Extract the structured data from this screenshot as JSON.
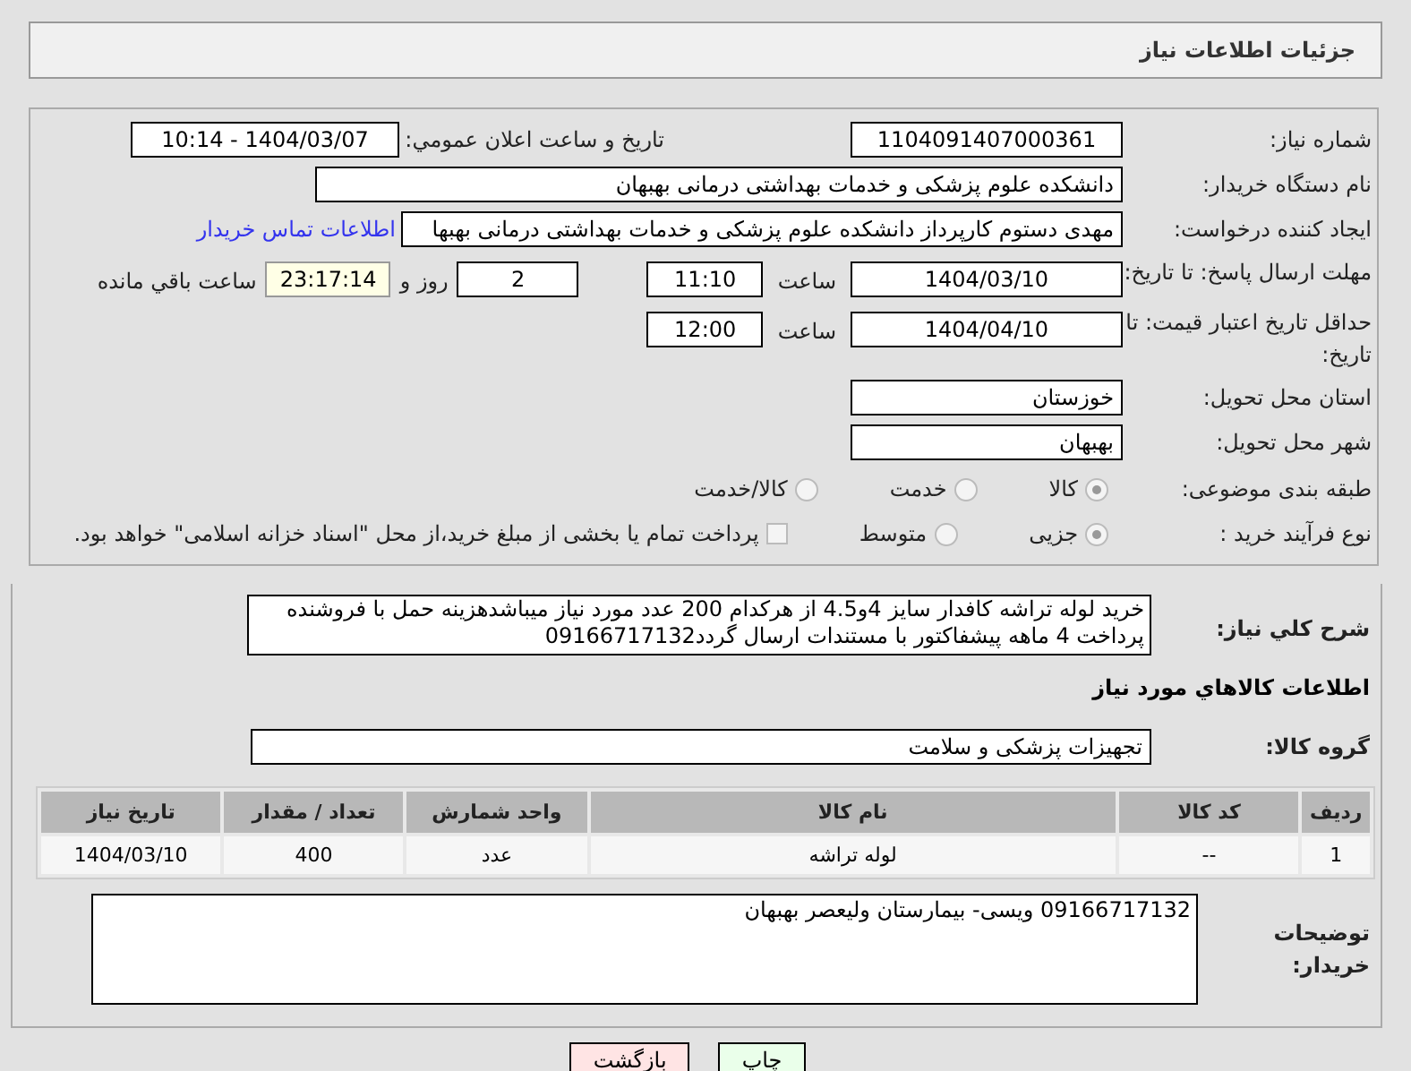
{
  "header": {
    "title": "جزئیات اطلاعات نیاز"
  },
  "fields": {
    "need_number": {
      "label": "شماره نیاز:",
      "value": "1104091407000361"
    },
    "announce": {
      "label": "تاریخ و ساعت اعلان عمومي:",
      "value": "1404/03/07 - 10:14"
    },
    "buyer": {
      "label": "نام دستگاه خریدار:",
      "value": "دانشکده علوم پزشکی و خدمات بهداشتی  درمانی بهبهان"
    },
    "creator": {
      "label": "ایجاد کننده درخواست:",
      "value": "مهدی دستوم کارپرداز دانشکده علوم پزشکی و خدمات بهداشتی  درمانی بهبها",
      "link": "اطلاعات تماس خریدار"
    },
    "deadline": {
      "label": "مهلت ارسال پاسخ: تا تاریخ:",
      "date": "1404/03/10",
      "time_label": "ساعت",
      "time": "11:10",
      "days": "2",
      "days_label": "روز و",
      "remaining": "23:17:14",
      "remaining_label": "ساعت باقي مانده"
    },
    "validity": {
      "label": "حداقل تاریخ اعتبار قیمت: تا تاریخ:",
      "date": "1404/04/10",
      "time_label": "ساعت",
      "time": "12:00"
    },
    "province": {
      "label": "استان محل تحویل:",
      "value": "خوزستان"
    },
    "city": {
      "label": "شهر محل تحویل:",
      "value": "بهبهان"
    }
  },
  "category": {
    "label": "طبقه بندی موضوعی:",
    "options": [
      {
        "label": "کالا",
        "selected": true
      },
      {
        "label": "خدمت",
        "selected": false
      },
      {
        "label": "کالا/خدمت",
        "selected": false
      }
    ]
  },
  "process": {
    "label": "نوع فرآیند خرید :",
    "options": [
      {
        "label": "جزیی",
        "selected": true
      },
      {
        "label": "متوسط",
        "selected": false
      }
    ],
    "treasury": {
      "label": "پرداخت تمام یا بخشی از مبلغ خرید،از محل \"اسناد خزانه اسلامی\" خواهد بود.",
      "checked": false
    }
  },
  "description": {
    "label": "شرح کلي نیاز:",
    "value": "خرید لوله تراشه کافدار سایز 4و4.5 از هرکدام 200 عدد مورد نیاز میباشدهزینه حمل با فروشنده پرداخت 4 ماهه پیشفاکتور با مستندات ارسال گردد09166717132"
  },
  "goods_heading": "اطلاعات کالاهاي مورد نیاز",
  "goods_group": {
    "label": "گروه کالا:",
    "value": "تجهیزات پزشکی و سلامت"
  },
  "table": {
    "columns": [
      "ردیف",
      "کد کالا",
      "نام کالا",
      "واحد شمارش",
      "تعداد / مقدار",
      "تاریخ نیاز"
    ],
    "rows": [
      [
        "1",
        "--",
        "لوله تراشه",
        "عدد",
        "400",
        "1404/03/10"
      ]
    ]
  },
  "buyer_notes": {
    "label": "توضیحات خریدار:",
    "value": "09166717132 ویسی- بیمارستان ولیعصر بهبهان"
  },
  "buttons": [
    {
      "label": "چاپ",
      "kind": "print"
    },
    {
      "label": "بازگشت",
      "kind": "back"
    }
  ]
}
